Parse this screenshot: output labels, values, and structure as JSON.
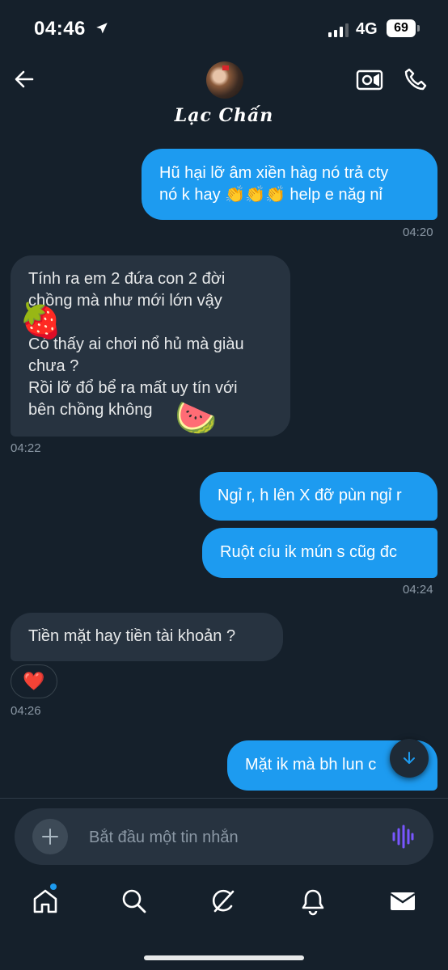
{
  "status_bar": {
    "time": "04:46",
    "network": "4G",
    "battery": "69"
  },
  "header": {
    "contact_name": "Lạc Chấn"
  },
  "messages": [
    {
      "type": "sent",
      "lines": [
        "Hũ hại lỡ âm xiền hàg nó trả cty",
        "nó k hay 👏👏👏 help e năg nỉ"
      ],
      "time": "04:20"
    },
    {
      "type": "received",
      "lines": [
        "Tính ra em 2 đứa con 2 đời",
        "chồng mà như mới lớn vậy",
        "?",
        "Có thấy ai chơi nổ hủ mà giàu",
        "chưa ?",
        "Rồi lỡ đổ bể ra mất uy tín với",
        "bên chồng không"
      ],
      "time": "04:22"
    },
    {
      "type": "sent",
      "lines": [
        "Ngỉ r, h lên X đỡ pùn ngỉ r"
      ]
    },
    {
      "type": "sent",
      "lines": [
        "Ruột cíu ik mún s cũg đc"
      ],
      "time": "04:24"
    },
    {
      "type": "received",
      "lines": [
        "Tiền mặt hay tiền tài khoản ?"
      ],
      "reaction": "❤️",
      "time": "04:26"
    },
    {
      "type": "sent",
      "lines": [
        "Mặt ik mà bh lun c"
      ]
    }
  ],
  "stickers": {
    "strawberry": "🍓",
    "watermelon": "🍉"
  },
  "composer": {
    "placeholder": "Bắt đầu một tin nhắn"
  },
  "tabbar": {
    "items": [
      "home-icon",
      "search-icon",
      "grok-icon",
      "notifications-icon",
      "messages-icon"
    ]
  },
  "colors": {
    "accent": "#1d9bf0",
    "background": "#15202b",
    "received_bubble": "#273340",
    "voice_icon": "#7856ff"
  }
}
